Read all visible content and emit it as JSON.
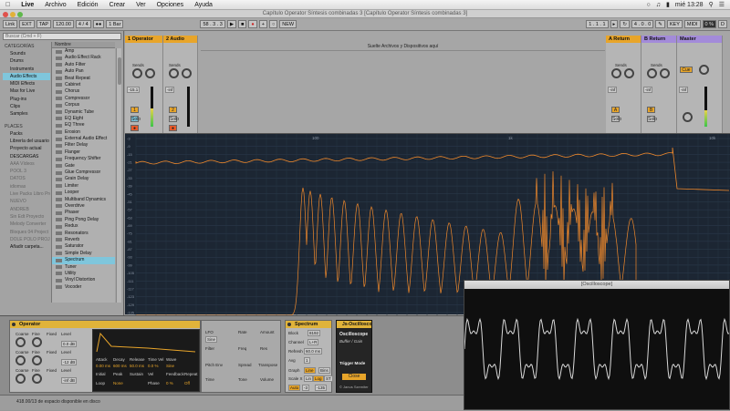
{
  "menubar": {
    "app": "Live",
    "items": [
      "Archivo",
      "Edición",
      "Crear",
      "Ver",
      "Opciones",
      "Ayuda"
    ],
    "clock": "mié 13:28"
  },
  "window": {
    "title": "Capítulo Operator Síntesis combinadas 3  [Capítulo Operator Síntesis combinadas 3]"
  },
  "transport": {
    "link": "Link",
    "ext": "EXT",
    "tap": "TAP",
    "tempo": "120.00",
    "meter": "4 / 4",
    "quant": "1 Bar",
    "position": "58 . 3 . 3",
    "new": "NEW",
    "key": "KEY",
    "midi": "MIDI",
    "cpu": "0 %",
    "d": "D"
  },
  "browser": {
    "search_placeholder": "Buscar (Cmd + F)",
    "categories_header": "CATEGORÍAS",
    "categories": [
      {
        "label": "Sounds"
      },
      {
        "label": "Drums"
      },
      {
        "label": "Instruments"
      },
      {
        "label": "Audio Effects",
        "selected": true
      },
      {
        "label": "MIDI Effects"
      },
      {
        "label": "Max for Live"
      },
      {
        "label": "Plug-ins"
      },
      {
        "label": "Clips"
      },
      {
        "label": "Samples"
      }
    ],
    "places_header": "PLACES",
    "places": [
      "Packs",
      "Librería del usuario",
      "Proyecto actual",
      "DESCARGAS",
      "AAA Vídeos",
      "POOL 3",
      "DATOS",
      "idiomas",
      "Live Packs Libro Pro",
      "NUEVO",
      "ANDREB",
      "Sin Edt Proyecto",
      "Melody Converter",
      "Bloques 04 Project",
      "DOLE POLO PROJ",
      "Añadir carpeta..."
    ],
    "names_header": "Nombre",
    "names": [
      "Amp",
      "Audio Effect Rack",
      "Auto Filter",
      "Auto Pan",
      "Beat Repeat",
      "Cabinet",
      "Chorus",
      "Compressor",
      "Corpus",
      "Dynamic Tube",
      "EQ Eight",
      "EQ Three",
      "Erosion",
      "External Audio Effect",
      "Filter Delay",
      "Flanger",
      "Frequency Shifter",
      "Gate",
      "Glue Compressor",
      "Grain Delay",
      "Limiter",
      "Looper",
      "Multiband Dynamics",
      "Overdrive",
      "Phaser",
      "Ping Pong Delay",
      "Redux",
      "Resonators",
      "Reverb",
      "Saturator",
      "Simple Delay",
      "Spectrum",
      "Tuner",
      "Utility",
      "Vinyl Distortion",
      "Vocoder"
    ],
    "selected_name": "Spectrum"
  },
  "session": {
    "tracks": [
      {
        "label": "1 Operator",
        "color": "#e8a52a"
      },
      {
        "label": "2 Audio",
        "color": "#e8a52a"
      },
      {
        "label": "A Return",
        "color": "#e8a52a"
      },
      {
        "label": "B Return",
        "color": "#a38bd9"
      },
      {
        "label": "Master",
        "color": "#a38bd9"
      }
    ],
    "drop_text": "Suelte Archivos y Dispositivos aquí",
    "track_nums": [
      "1",
      "2",
      "A",
      "B"
    ],
    "sends_label": "Sends",
    "post": "Post",
    "auto": "Auto",
    "ins": [
      "In",
      "Auto",
      "Off"
    ],
    "vol_values": [
      "-15.1",
      "-inf",
      "-inf",
      "-inf",
      "-inf"
    ],
    "db_marks": [
      "0",
      "12",
      "24",
      "36",
      "48",
      "60"
    ],
    "cue": "Cue",
    "solo": "Solo"
  },
  "spectrum": {
    "freq_labels": [
      "100",
      "1k",
      "10k"
    ],
    "db_labels": [
      "-3",
      "-9",
      "-15",
      "-21",
      "-27",
      "-33",
      "-39",
      "-45",
      "-51",
      "-57",
      "-63",
      "-69",
      "-75",
      "-81",
      "-87",
      "-93",
      "-99",
      "-105",
      "-111",
      "-117",
      "-123",
      "-129",
      "-135"
    ],
    "color": "#f0892b"
  },
  "devices": {
    "operator": {
      "title": "Operator",
      "rows": [
        {
          "coarse": "Coarse",
          "fine": "Fine",
          "fixed": "Fixed",
          "level": "Level",
          "val": "0.0 dB"
        },
        {
          "coarse": "Coarse",
          "fine": "Fine",
          "fixed": "Fixed",
          "level": "Level",
          "val": "-12 dB"
        },
        {
          "coarse": "Coarse",
          "fine": "Fine",
          "fixed": "Fixed",
          "level": "Level",
          "val": "-inf dB"
        }
      ],
      "env": {
        "attack_lbl": "Attack",
        "decay_lbl": "Decay",
        "release_lbl": "Release",
        "time_vel": "Time Vel",
        "wave": "Wave",
        "attack": "0.00 ms",
        "decay": "600 ms",
        "release": "50.0 ms",
        "tvel": "0.0 %",
        "initial_lbl": "Initial",
        "peak_lbl": "Peak",
        "sustain_lbl": "Sustain",
        "vel_lbl": "Vel",
        "feedback": "Feedback",
        "repeat": "Repeat",
        "loop": "Loop",
        "none": "None",
        "phase": "Phase",
        "quantize": "Quantize",
        "zero": "0 %",
        "off": "Off",
        "sine": "Sine",
        "orig": "Orig",
        "oscillator": "Oscillator",
        "time": "Time",
        "tone": "Tone",
        "volume": "Volume",
        "lfo": "LFO",
        "rate": "Rate",
        "amount": "Amount",
        "filter": "Filter",
        "freq": "Freq",
        "res": "Res",
        "pitch_env": "Pitch Env",
        "spread": "Spread",
        "transpose": "Transpose"
      }
    },
    "spectrum": {
      "title": "Spectrum",
      "block": "Block",
      "block_val": "8192",
      "channel": "Channel",
      "channel_val": "L+R",
      "refresh": "Refresh",
      "refresh_val": "60.0 ms",
      "avg": "Avg",
      "avg_val": "1",
      "graph": "Graph",
      "line": "Line",
      "bins": "Bins",
      "scale": "Scale X",
      "lin": "Lin",
      "log": "Log",
      "st": "ST",
      "auto": "Auto",
      "range": "Range",
      "r1": "-3",
      "r2": "-135"
    },
    "scope": {
      "title": "Js-Oscilloscope",
      "name": "Oscilloscope",
      "sub": "Buffer / Gain",
      "trigger": "Trigger Mode",
      "close": "Close",
      "footer": "© Janus Szemiter"
    }
  },
  "status": {
    "text": "418.00/13 de espacio disponible en disco"
  },
  "oscilloscope": {
    "title": "[Oscilloscope]"
  }
}
